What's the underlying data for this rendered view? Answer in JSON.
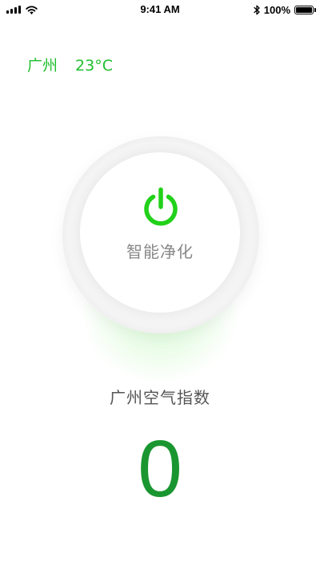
{
  "status_bar": {
    "time": "9:41 AM",
    "battery_percent": "100%",
    "battery_level": 1.0,
    "signal_bars": 4,
    "icons": [
      "signal-icon",
      "wifi-icon",
      "bluetooth-icon",
      "battery-icon"
    ]
  },
  "location": {
    "city": "广州",
    "temperature": "23°C"
  },
  "power": {
    "icon": "power-icon",
    "label": "智能净化"
  },
  "aqi": {
    "label": "广州空气指数",
    "value": "0"
  },
  "colors": {
    "accent": "#1fbf2d",
    "power_icon": "#22d11a",
    "aqi_value": "#1a9630",
    "label_gray": "#888888",
    "text_dark": "#555555"
  }
}
